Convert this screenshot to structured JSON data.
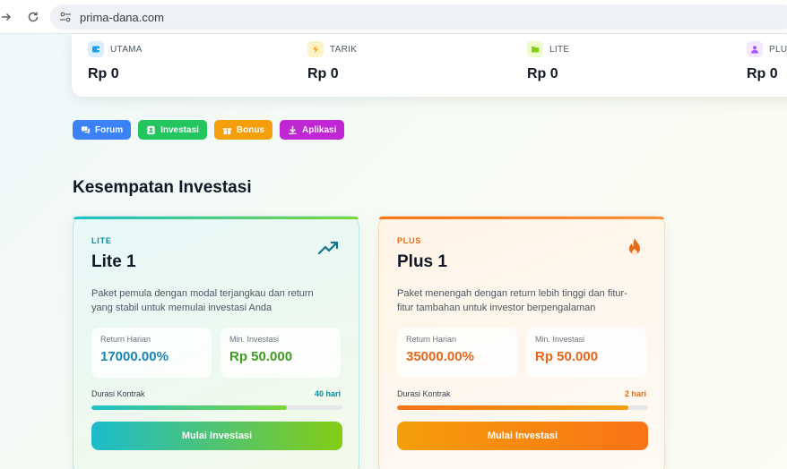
{
  "browser": {
    "url": "prima-dana.com",
    "icons": {
      "forward": "arrow-right-icon",
      "reload": "reload-icon",
      "site": "site-settings-icon"
    }
  },
  "balances": [
    {
      "label": "UTAMA",
      "value": "Rp 0",
      "icon": "wallet-icon",
      "color": "#0ea5e9"
    },
    {
      "label": "TARIK",
      "value": "Rp 0",
      "icon": "lightning-icon",
      "color": "#f59e0b"
    },
    {
      "label": "LITE",
      "value": "Rp 0",
      "icon": "folder-icon",
      "color": "#84cc16"
    },
    {
      "label": "PLUS",
      "value": "Rp 0",
      "icon": "user-icon",
      "color": "#a855f7"
    }
  ],
  "actions": [
    {
      "label": "Forum",
      "icon": "chat-icon",
      "color": "#3b82f6"
    },
    {
      "label": "Investasi",
      "icon": "portfolio-icon",
      "color": "#22c55e"
    },
    {
      "label": "Bonus",
      "icon": "gift-icon",
      "color": "#f59e0b"
    },
    {
      "label": "Aplikasi",
      "icon": "download-icon",
      "color": "#c026d3"
    }
  ],
  "section_title": "Kesempatan Investasi",
  "plans": [
    {
      "tag": "LITE",
      "name": "Lite 1",
      "icon": "trending-up-icon",
      "description": "Paket pemula dengan modal terjangkau dan return yang stabil untuk memulai investasi Anda",
      "return_label": "Return Harian",
      "return_value": "17000.00%",
      "min_label": "Min. Investasi",
      "min_value": "Rp 50.000",
      "duration_label": "Durasi Kontrak",
      "duration_value": "40 hari",
      "progress": 0.78,
      "button_label": "Mulai Investasi"
    },
    {
      "tag": "PLUS",
      "name": "Plus 1",
      "icon": "fire-icon",
      "description": "Paket menengah dengan return lebih tinggi dan fitur-fitur tambahan untuk investor berpengalaman",
      "return_label": "Return Harian",
      "return_value": "35000.00%",
      "min_label": "Min. Investasi",
      "min_value": "Rp 50.000",
      "duration_label": "Durasi Kontrak",
      "duration_value": "2 hari",
      "progress": 0.92,
      "button_label": "Mulai Investasi"
    }
  ]
}
